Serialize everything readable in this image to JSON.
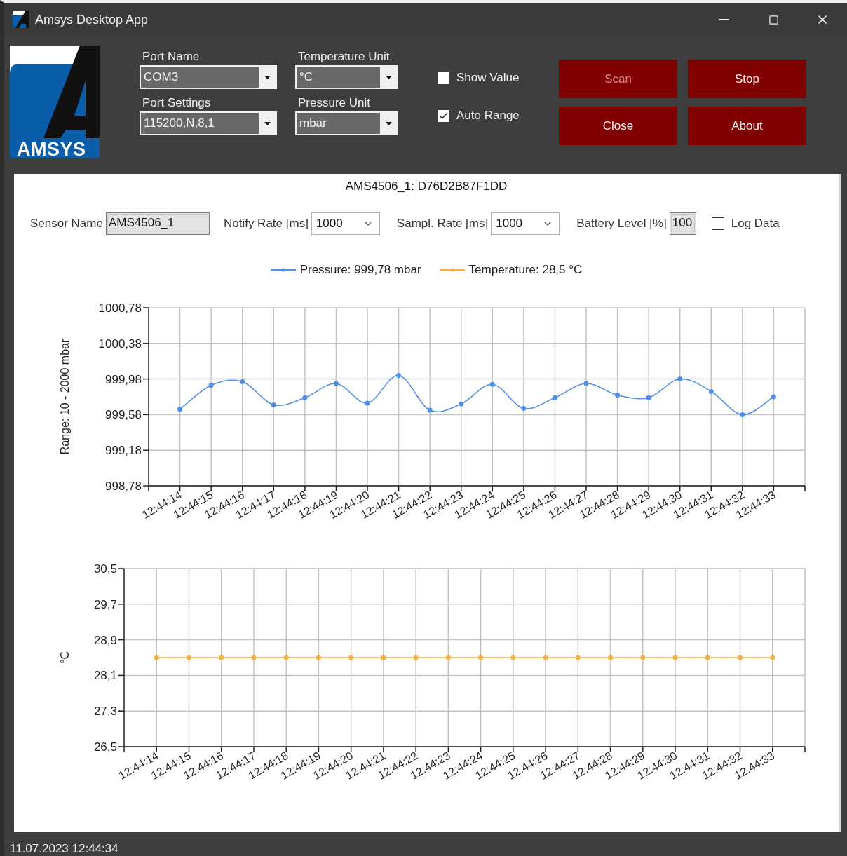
{
  "window": {
    "title": "Amsys Desktop App"
  },
  "logo": {
    "text": "AMSYS"
  },
  "combos": [
    {
      "label": "Port Name",
      "value": "COM3"
    },
    {
      "label": "Temperature Unit",
      "value": "°C"
    },
    {
      "label": "Port Settings",
      "value": "115200,N,8,1"
    },
    {
      "label": "Pressure Unit",
      "value": "mbar"
    }
  ],
  "options": [
    {
      "label": "Show Value",
      "checked": false
    },
    {
      "label": "Auto Range",
      "checked": true
    }
  ],
  "buttons": [
    {
      "label": "Scan",
      "disabled": true
    },
    {
      "label": "Stop",
      "disabled": false
    },
    {
      "label": "Close",
      "disabled": false
    },
    {
      "label": "About",
      "disabled": false
    }
  ],
  "panel": {
    "title": "AMS4506_1: D76D2B87F1DD",
    "fields": [
      {
        "kind": "text",
        "label": "Sensor Name",
        "value": "AMS4506_1"
      },
      {
        "kind": "select",
        "label": "Notify Rate [ms]",
        "value": "1000"
      },
      {
        "kind": "select",
        "label": "Sampl. Rate [ms]",
        "value": "1000"
      },
      {
        "kind": "number",
        "label": "Battery Level [%]",
        "value": "100"
      },
      {
        "kind": "checkbox",
        "label": "Log Data",
        "checked": false
      }
    ],
    "legend": [
      {
        "label": "Pressure: 999,78 mbar",
        "color": "#4f8fe6"
      },
      {
        "label": "Temperature: 28,5 °C",
        "color": "#f5b240"
      }
    ],
    "charts": [
      {
        "chart_data": {
          "type": "line",
          "ylabel": "Range: 10 - 2000 mbar",
          "categories": [
            "12:44:14",
            "12:44:15",
            "12:44:16",
            "12:44:17",
            "12:44:18",
            "12:44:19",
            "12:44:20",
            "12:44:21",
            "12:44:22",
            "12:44:23",
            "12:44:24",
            "12:44:25",
            "12:44:26",
            "12:44:27",
            "12:44:28",
            "12:44:29",
            "12:44:30",
            "12:44:31",
            "12:44:32",
            "12:44:33"
          ],
          "ylim": [
            998.78,
            1000.78
          ],
          "yticks": [
            {
              "value": 998.78,
              "label": "998,78"
            },
            {
              "value": 999.18,
              "label": "999,18"
            },
            {
              "value": 999.58,
              "label": "999,58"
            },
            {
              "value": 999.98,
              "label": "999,98"
            },
            {
              "value": 1000.38,
              "label": "1000,38"
            },
            {
              "value": 1000.78,
              "label": "1000,78"
            }
          ],
          "grid": true,
          "series": [
            {
              "color": "#4f8fe6",
              "marker": "circle",
              "values": [
                999.64,
                999.91,
                999.95,
                999.69,
                999.77,
                999.93,
                999.71,
                1000.02,
                999.63,
                999.7,
                999.92,
                999.65,
                999.77,
                999.93,
                999.8,
                999.77,
                999.98,
                999.84,
                999.58,
                999.78
              ]
            }
          ]
        }
      },
      {
        "chart_data": {
          "type": "line",
          "ylabel": "°C",
          "categories": [
            "12:44:14",
            "12:44:15",
            "12:44:16",
            "12:44:17",
            "12:44:18",
            "12:44:19",
            "12:44:20",
            "12:44:21",
            "12:44:22",
            "12:44:23",
            "12:44:24",
            "12:44:25",
            "12:44:26",
            "12:44:27",
            "12:44:28",
            "12:44:29",
            "12:44:30",
            "12:44:31",
            "12:44:32",
            "12:44:33"
          ],
          "ylim": [
            26.5,
            30.5
          ],
          "yticks": [
            {
              "value": 26.5,
              "label": "26,5"
            },
            {
              "value": 27.3,
              "label": "27,3"
            },
            {
              "value": 28.1,
              "label": "28,1"
            },
            {
              "value": 28.9,
              "label": "28,9"
            },
            {
              "value": 29.7,
              "label": "29,7"
            },
            {
              "value": 30.5,
              "label": "30,5"
            }
          ],
          "grid": true,
          "series": [
            {
              "color": "#f5b240",
              "marker": "circle",
              "values": [
                28.5,
                28.5,
                28.5,
                28.5,
                28.5,
                28.5,
                28.5,
                28.5,
                28.5,
                28.5,
                28.5,
                28.5,
                28.5,
                28.5,
                28.5,
                28.5,
                28.5,
                28.5,
                28.5,
                28.5
              ]
            }
          ]
        }
      }
    ]
  },
  "status_bar": {
    "text": "11.07.2023 12:44:34"
  }
}
